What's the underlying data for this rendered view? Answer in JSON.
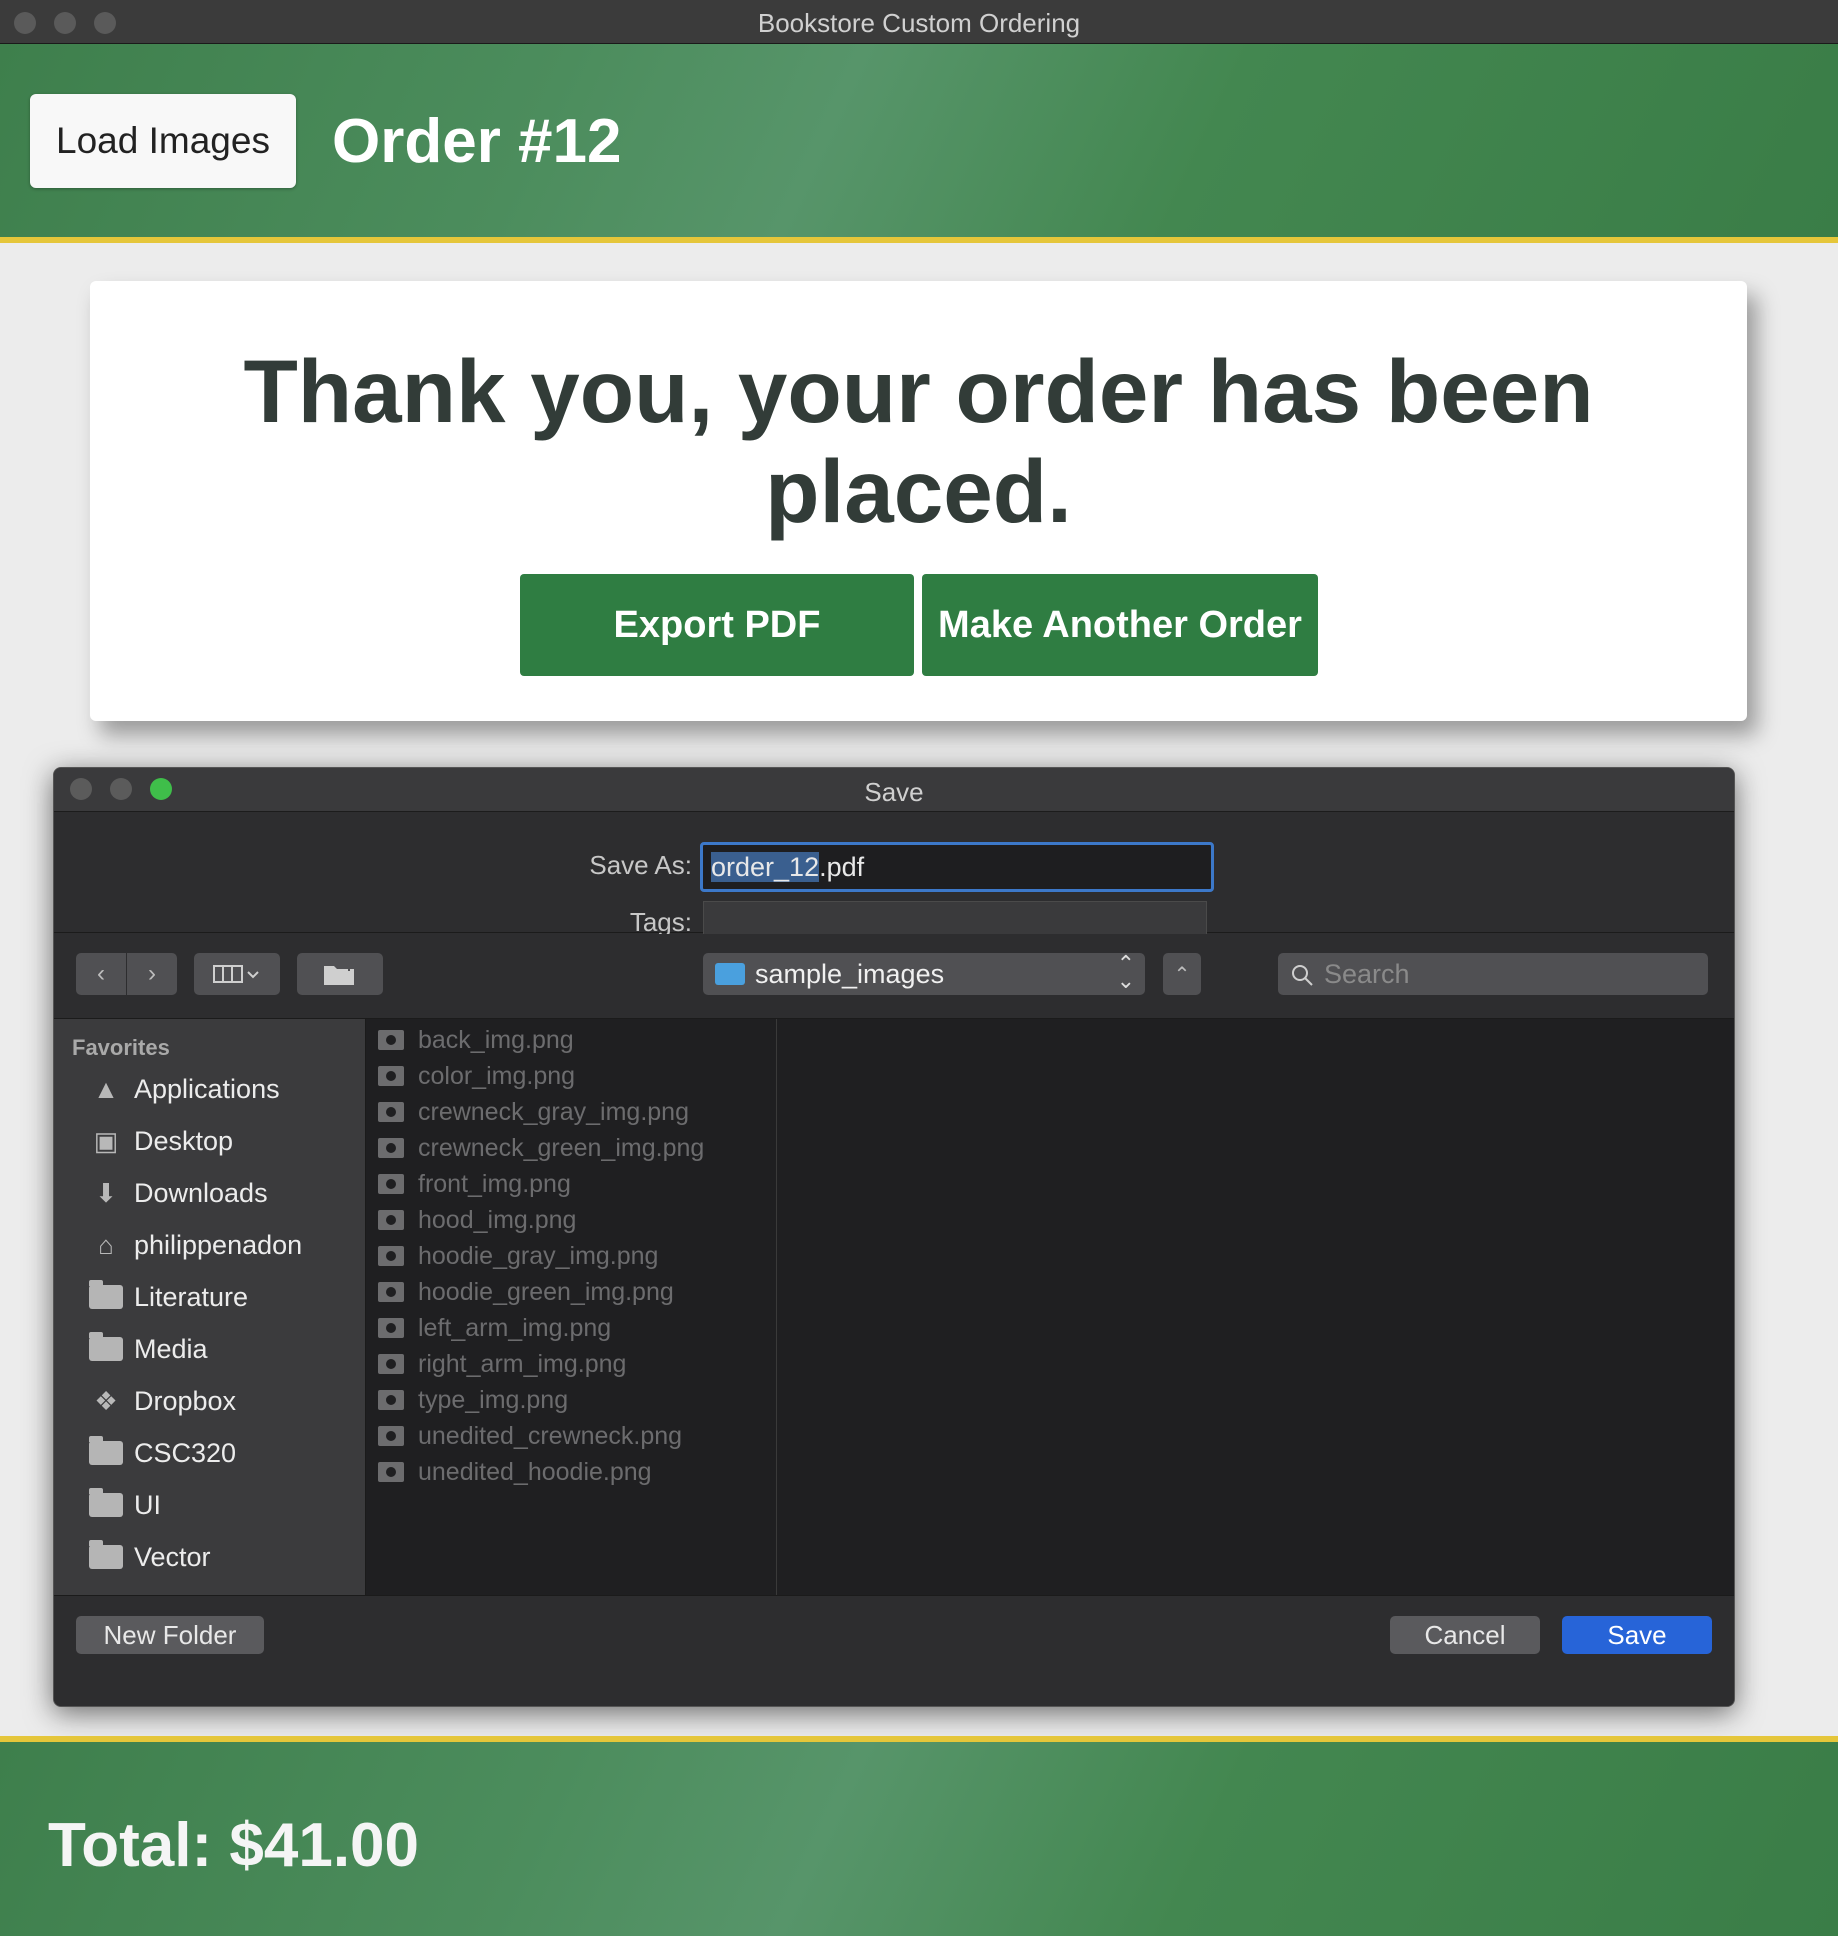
{
  "window": {
    "title": "Bookstore Custom Ordering"
  },
  "header": {
    "load_label": "Load Images",
    "order_title": "Order #12"
  },
  "card": {
    "message": "Thank you, your order has been placed.",
    "export_label": "Export PDF",
    "another_label": "Make Another Order"
  },
  "dialog": {
    "title": "Save",
    "save_as_label": "Save As:",
    "filename_selected": "order_12",
    "filename_ext": ".pdf",
    "tags_label": "Tags:",
    "location": "sample_images",
    "search_placeholder": "Search",
    "favorites_label": "Favorites",
    "sidebar": [
      {
        "label": "Applications",
        "icon": "applications-icon"
      },
      {
        "label": "Desktop",
        "icon": "desktop-icon"
      },
      {
        "label": "Downloads",
        "icon": "downloads-icon"
      },
      {
        "label": "philippenadon",
        "icon": "home-icon"
      },
      {
        "label": "Literature",
        "icon": "folder-icon"
      },
      {
        "label": "Media",
        "icon": "folder-icon"
      },
      {
        "label": "Dropbox",
        "icon": "dropbox-icon"
      },
      {
        "label": "CSC320",
        "icon": "folder-icon"
      },
      {
        "label": "UI",
        "icon": "folder-icon"
      },
      {
        "label": "Vector",
        "icon": "folder-icon"
      }
    ],
    "files": [
      "back_img.png",
      "color_img.png",
      "crewneck_gray_img.png",
      "crewneck_green_img.png",
      "front_img.png",
      "hood_img.png",
      "hoodie_gray_img.png",
      "hoodie_green_img.png",
      "left_arm_img.png",
      "right_arm_img.png",
      "type_img.png",
      "unedited_crewneck.png",
      "unedited_hoodie.png"
    ],
    "new_folder_label": "New Folder",
    "cancel_label": "Cancel",
    "save_label": "Save"
  },
  "footer": {
    "total": "Total: $41.00"
  },
  "colors": {
    "header_green": "#3e7f4c",
    "accent_yellow": "#e5c63a",
    "button_green": "#2f7d42",
    "save_blue": "#2764d8"
  }
}
